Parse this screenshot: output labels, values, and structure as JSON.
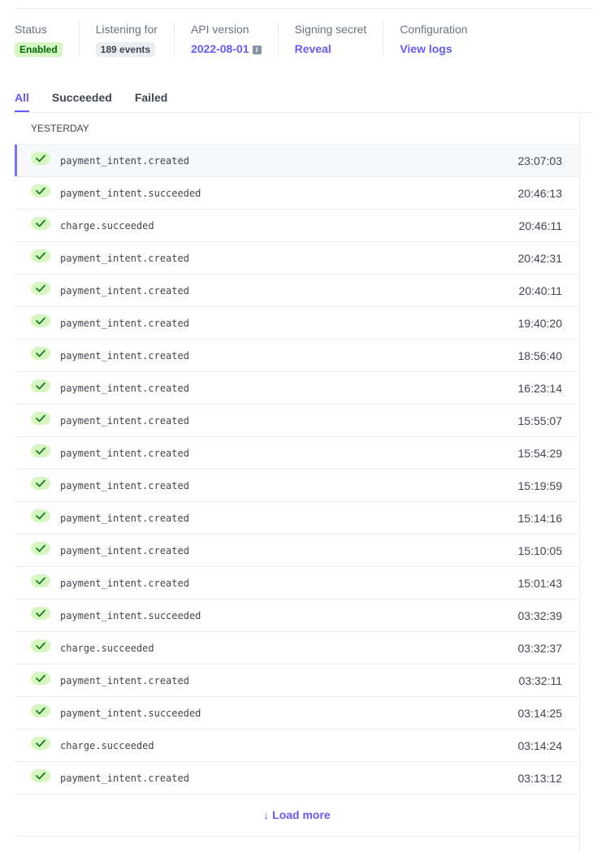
{
  "stats": {
    "status_label": "Status",
    "status_value": "Enabled",
    "listening_label": "Listening for",
    "listening_value": "189 events",
    "api_label": "API version",
    "api_value": "2022-08-01",
    "secret_label": "Signing secret",
    "secret_value": "Reveal",
    "config_label": "Configuration",
    "config_value": "View logs"
  },
  "tabs": [
    {
      "label": "All",
      "active": true
    },
    {
      "label": "Succeeded",
      "active": false
    },
    {
      "label": "Failed",
      "active": false
    }
  ],
  "group_label": "Yesterday",
  "events": [
    {
      "name": "payment_intent.created",
      "time": "23:07:03",
      "selected": true
    },
    {
      "name": "payment_intent.succeeded",
      "time": "20:46:13"
    },
    {
      "name": "charge.succeeded",
      "time": "20:46:11"
    },
    {
      "name": "payment_intent.created",
      "time": "20:42:31"
    },
    {
      "name": "payment_intent.created",
      "time": "20:40:11"
    },
    {
      "name": "payment_intent.created",
      "time": "19:40:20"
    },
    {
      "name": "payment_intent.created",
      "time": "18:56:40"
    },
    {
      "name": "payment_intent.created",
      "time": "16:23:14"
    },
    {
      "name": "payment_intent.created",
      "time": "15:55:07"
    },
    {
      "name": "payment_intent.created",
      "time": "15:54:29"
    },
    {
      "name": "payment_intent.created",
      "time": "15:19:59"
    },
    {
      "name": "payment_intent.created",
      "time": "15:14:16"
    },
    {
      "name": "payment_intent.created",
      "time": "15:10:05"
    },
    {
      "name": "payment_intent.created",
      "time": "15:01:43"
    },
    {
      "name": "payment_intent.succeeded",
      "time": "03:32:39"
    },
    {
      "name": "charge.succeeded",
      "time": "03:32:37"
    },
    {
      "name": "payment_intent.created",
      "time": "03:32:11"
    },
    {
      "name": "payment_intent.succeeded",
      "time": "03:14:25"
    },
    {
      "name": "charge.succeeded",
      "time": "03:14:24"
    },
    {
      "name": "payment_intent.created",
      "time": "03:13:12"
    }
  ],
  "load_more": {
    "icon": "arrow-down-icon",
    "label": "Load more"
  },
  "colors": {
    "accent": "#635bff",
    "success_bg": "#d7f7c2",
    "success_fg": "#006908"
  }
}
